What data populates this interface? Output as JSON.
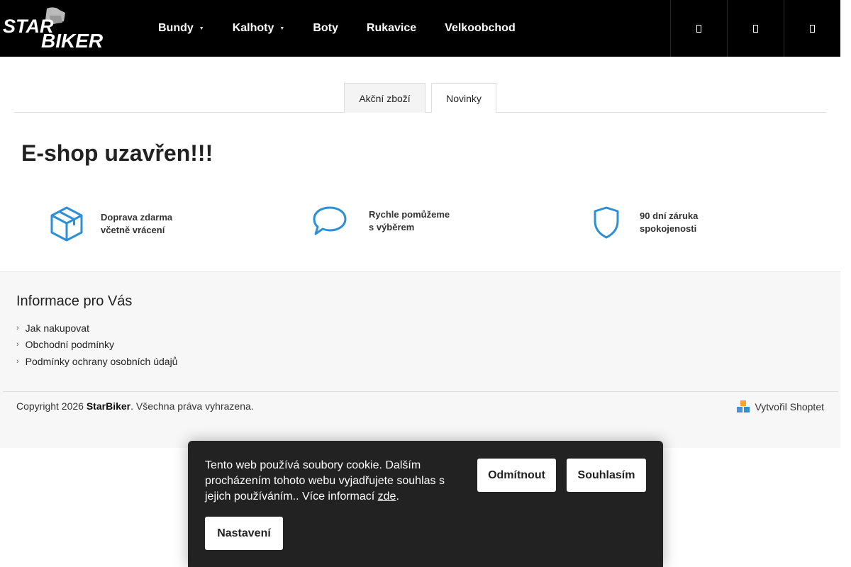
{
  "header": {
    "logo_top": "STAR",
    "logo_bottom": "BIKER",
    "nav": [
      {
        "label": "Bundy",
        "has_dropdown": true
      },
      {
        "label": "Kalhoty",
        "has_dropdown": true
      },
      {
        "label": "Boty",
        "has_dropdown": false
      },
      {
        "label": "Rukavice",
        "has_dropdown": false
      },
      {
        "label": "Velkoobchod",
        "has_dropdown": false
      }
    ],
    "icons": [
      "search-icon",
      "user-icon",
      "cart-icon"
    ]
  },
  "tabs": [
    {
      "label": "Akční zboží",
      "active": true
    },
    {
      "label": "Novinky",
      "active": false
    }
  ],
  "main": {
    "title": "E-shop uzavřen!!!"
  },
  "benefits": [
    {
      "icon": "box-icon",
      "line1": "Doprava zdarma",
      "line2": "včetně vrácení"
    },
    {
      "icon": "speech-bubble-icon",
      "line1": "Rychle pomůžeme",
      "line2": "s výběrem"
    },
    {
      "icon": "shield-icon",
      "line1": "90 dní záruka",
      "line2": "spokojenosti"
    }
  ],
  "footer": {
    "heading": "Informace pro Vás",
    "links": [
      "Jak nakupovat",
      "Obchodní podmínky",
      "Podmínky ochrany osobních údajů"
    ],
    "copyright_prefix": "Copyright 2026",
    "brand": "StarBiker",
    "copyright_suffix": ". Všechna práva vyhrazena.",
    "created_by": "Vytvořil Shoptet"
  },
  "cookie": {
    "message": "Tento web používá soubory cookie. Dalším procházením tohoto webu vyjadřujete souhlas s jejich používáním.. Více informací ",
    "link_label": "zde",
    "after_link": ".",
    "reject_label": "Odmítnout",
    "accept_label": "Souhlasím",
    "settings_label": "Nastavení"
  },
  "colors": {
    "header_bg": "#000000",
    "accent_blue": "#2d8fd5",
    "cookie_bg": "#222222",
    "footer_bg": "#f7f7f7"
  }
}
